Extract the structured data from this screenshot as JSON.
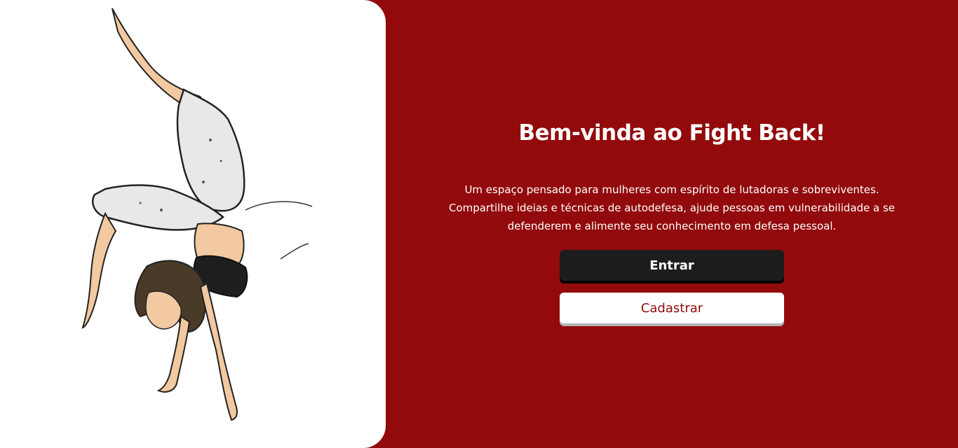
{
  "hero": {
    "title": "Bem-vinda ao Fight Back!",
    "description_lines": [
      "Um espaço pensado para mulheres com espírito de lutadoras e sobreviventes.",
      "Compartilhe ideias e técnicas de autodefesa, ajude pessoas em vulnerabilidade a se",
      "defenderem e alimente seu conhecimento em defesa pessoal."
    ]
  },
  "actions": {
    "login_label": "Entrar",
    "signup_label": "Cadastrar"
  },
  "illustration": {
    "subject": "woman-handstand-capoeira-drawing"
  },
  "colors": {
    "background": "#920a0c",
    "panel": "#ffffff",
    "primary_button": "#1d1d1d",
    "secondary_button_text": "#920a0c"
  }
}
